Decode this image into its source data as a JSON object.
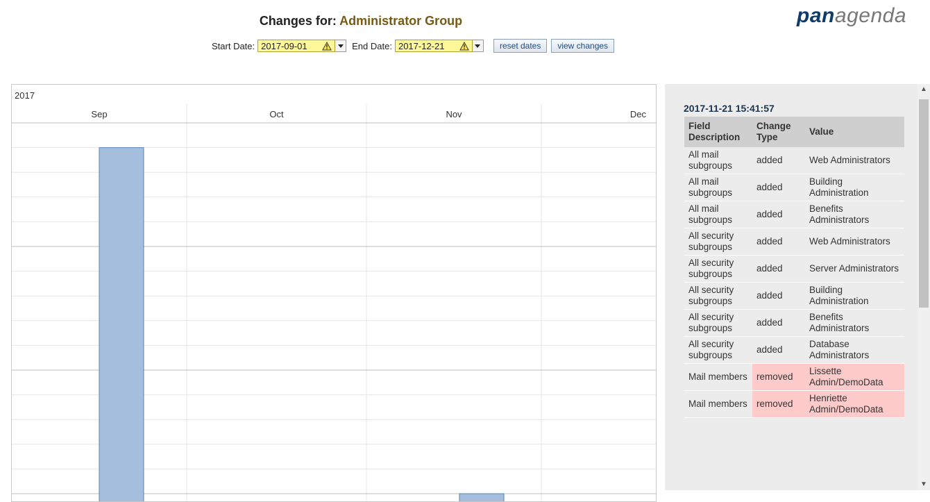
{
  "header": {
    "title_prefix": "Changes for:",
    "group_name": "Administrator Group",
    "logo_bold": "pan",
    "logo_light": "agenda"
  },
  "toolbar": {
    "start_label": "Start Date:",
    "start_value": "2017-09-01",
    "end_label": "End Date:",
    "end_value": "2017-12-21",
    "reset_label": "reset dates",
    "view_label": "view changes"
  },
  "chart_data": {
    "type": "bar",
    "year_label": "2017",
    "months": [
      "Sep",
      "Oct",
      "Nov",
      "Dec"
    ],
    "bars": [
      {
        "month": "Sep",
        "value": 15
      },
      {
        "month": "Nov",
        "value": 1
      }
    ],
    "ylim": [
      0,
      16
    ],
    "grid": true
  },
  "detail": {
    "timestamp": "2017-11-21 15:41:57",
    "headers": [
      "Field Description",
      "Change Type",
      "Value"
    ],
    "rows": [
      {
        "field": "All mail subgroups",
        "type": "added",
        "value": "Web Administrators"
      },
      {
        "field": "All mail subgroups",
        "type": "added",
        "value": "Building Administration"
      },
      {
        "field": "All mail subgroups",
        "type": "added",
        "value": "Benefits Administrators"
      },
      {
        "field": "All security subgroups",
        "type": "added",
        "value": "Web Administrators"
      },
      {
        "field": "All security subgroups",
        "type": "added",
        "value": "Server Administrators"
      },
      {
        "field": "All security subgroups",
        "type": "added",
        "value": "Building Administration"
      },
      {
        "field": "All security subgroups",
        "type": "added",
        "value": "Benefits Administrators"
      },
      {
        "field": "All security subgroups",
        "type": "added",
        "value": "Database Administrators"
      },
      {
        "field": "Mail members",
        "type": "removed",
        "value": "Lissette Admin/DemoData"
      },
      {
        "field": "Mail members",
        "type": "removed",
        "value": "Henriette Admin/DemoData"
      }
    ]
  },
  "colors": {
    "bar_fill": "#a6bedd",
    "bar_stroke": "#5b83b5",
    "removed_bg": "#ffcaca",
    "date_bg": "#fdf89a"
  }
}
